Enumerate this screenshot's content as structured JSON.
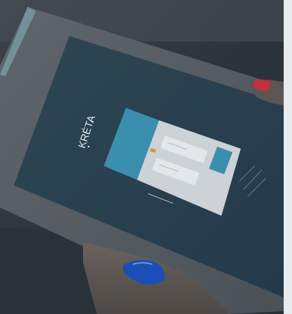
{
  "photo": {
    "subject": "hand-holding-tablet",
    "logo_text": "KRÉTA",
    "screen": {
      "color": "#3d5563",
      "login_banner_color": "#3a8fae",
      "login_form_color": "#d6dadd",
      "button_color": "#3a8fae"
    },
    "nail_color": "#1a4fb8",
    "accent_nail_color": "#c2303a"
  }
}
